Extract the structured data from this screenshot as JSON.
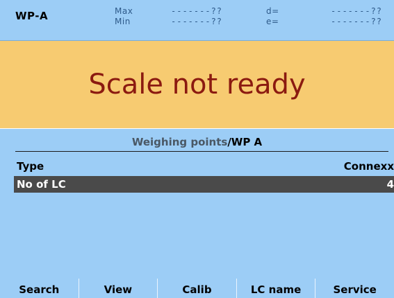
{
  "header": {
    "wp_label": "WP-A",
    "max_label": "Max",
    "min_label": "Min",
    "max_value": "-------??",
    "min_value": "-------??",
    "d_label": "d=",
    "e_label": "e=",
    "d_value": "-------??",
    "e_value": "-------??"
  },
  "status": {
    "message": "Scale not ready"
  },
  "breadcrumb": {
    "path": "Weighing points",
    "separator": "/",
    "current": "WP A"
  },
  "rows": [
    {
      "label": "Type",
      "value": "Connexx"
    },
    {
      "label": "No of LC",
      "value": "4"
    }
  ],
  "softkeys": [
    "Search",
    "View",
    "Calib",
    "LC name",
    "Service"
  ],
  "colors": {
    "panel_bg": "#9ccdf6",
    "banner_bg": "#f7cb71",
    "banner_text": "#8b1a10",
    "selected_row": "#4a4a4a"
  }
}
